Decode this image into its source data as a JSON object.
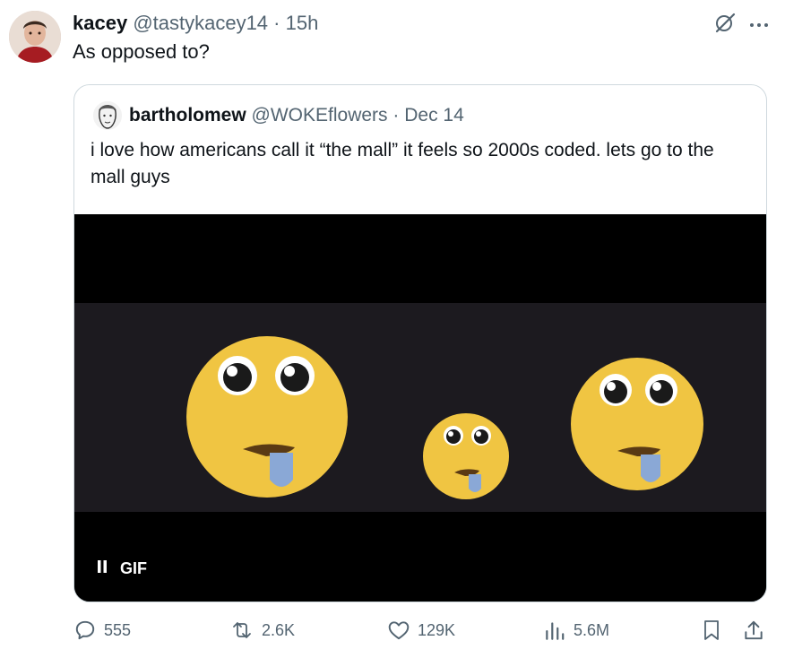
{
  "tweet": {
    "author_name": "kacey",
    "author_handle": "@tastykacey14",
    "separator": "·",
    "time": "15h",
    "text": "As opposed to?"
  },
  "quoted_tweet": {
    "author_name": "bartholomew",
    "author_handle": "@WOKEflowers",
    "separator": "·",
    "date": "Dec 14",
    "text": "i love how americans call it “the mall” it feels so 2000s coded. lets go to the mall guys",
    "media": {
      "type": "gif",
      "badge_label": "GIF",
      "state": "playing"
    }
  },
  "actions": {
    "replies": "555",
    "reposts": "2.6K",
    "likes": "129K",
    "views": "5.6M"
  },
  "icons": [
    "grok-icon",
    "more-icon",
    "pause-icon",
    "reply-icon",
    "repost-icon",
    "like-icon",
    "views-icon",
    "bookmark-icon",
    "share-icon"
  ],
  "colors": {
    "text": "#0f1419",
    "secondary": "#536471",
    "border": "#cfd9de",
    "emoji": "#f2c94c"
  }
}
